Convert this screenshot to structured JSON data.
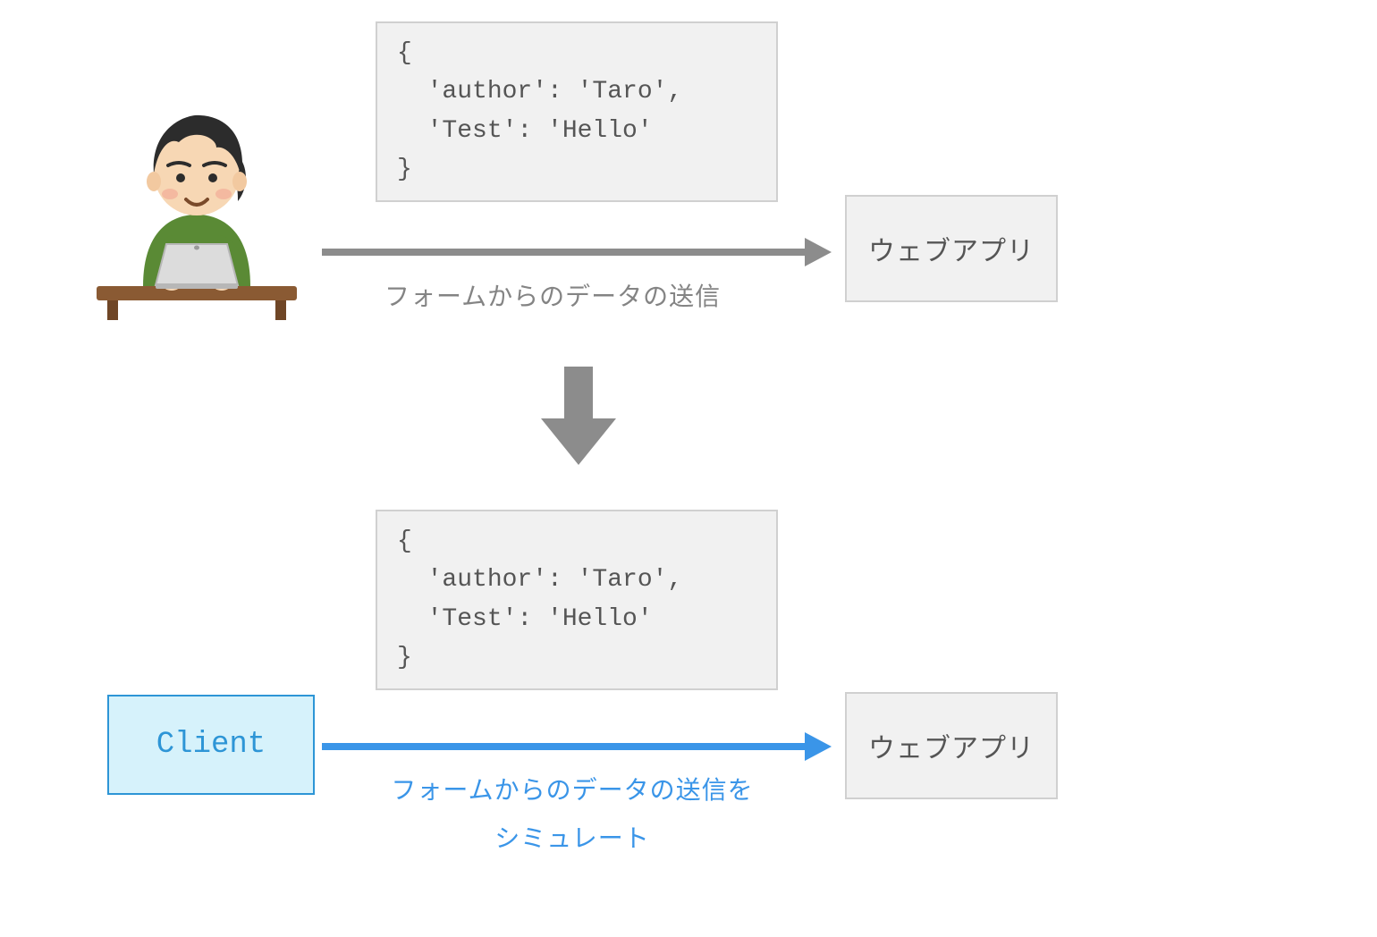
{
  "top": {
    "code": "{\n  'author': 'Taro',\n  'Test': 'Hello'\n}",
    "arrow_caption": "フォームからのデータの送信",
    "webapp_label": "ウェブアプリ"
  },
  "bottom": {
    "client_label": "Client",
    "code": "{\n  'author': 'Taro',\n  'Test': 'Hello'\n}",
    "arrow_caption_line1": "フォームからのデータの送信を",
    "arrow_caption_line2": "シミュレート",
    "webapp_label": "ウェブアプリ"
  },
  "colors": {
    "gray_arrow": "#8c8c8c",
    "blue_arrow": "#3a95e8",
    "box_bg": "#f1f1f1",
    "box_border": "#d0d0d0",
    "client_bg": "#d6f2fb",
    "client_border": "#2d95d6"
  }
}
